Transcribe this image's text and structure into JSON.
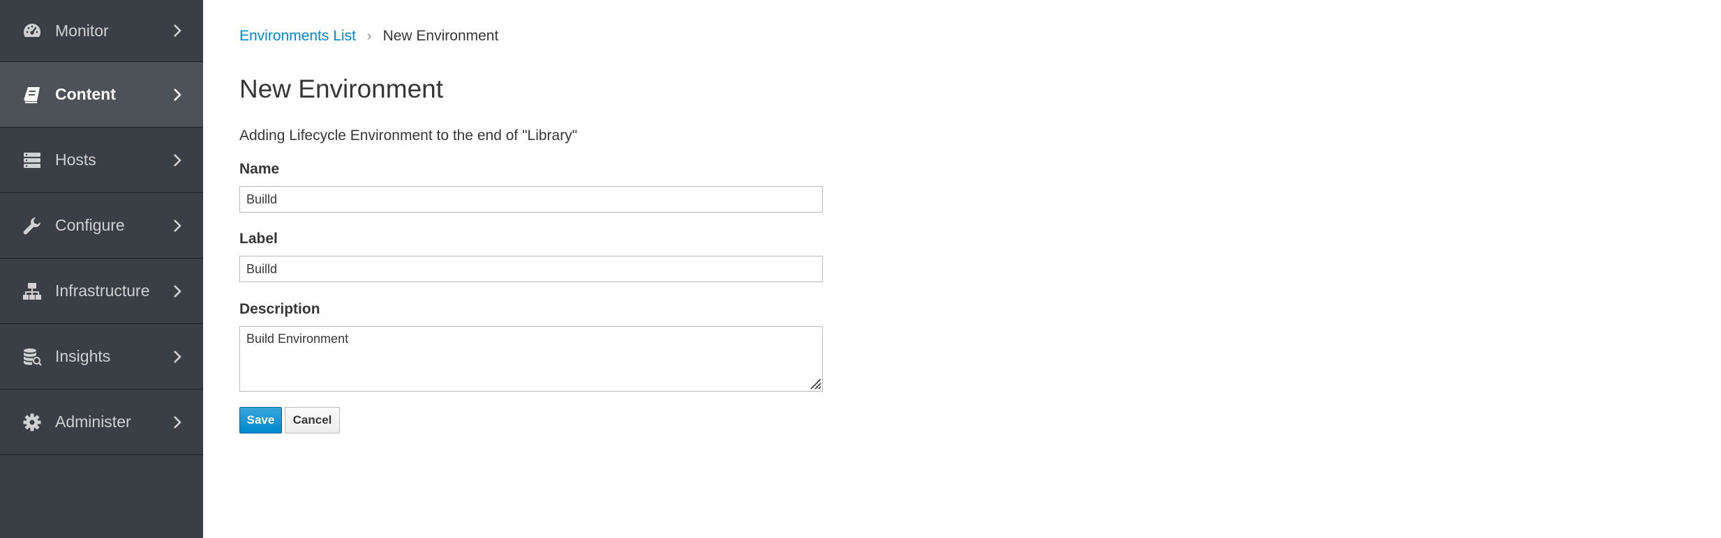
{
  "sidebar": {
    "items": [
      {
        "label": "Monitor",
        "icon": "dashboard-icon",
        "active": false
      },
      {
        "label": "Content",
        "icon": "book-icon",
        "active": true
      },
      {
        "label": "Hosts",
        "icon": "server-icon",
        "active": false
      },
      {
        "label": "Configure",
        "icon": "wrench-icon",
        "active": false
      },
      {
        "label": "Infrastructure",
        "icon": "network-icon",
        "active": false
      },
      {
        "label": "Insights",
        "icon": "database-search-icon",
        "active": false
      },
      {
        "label": "Administer",
        "icon": "gear-icon",
        "active": false
      }
    ]
  },
  "breadcrumb": {
    "parent": "Environments List",
    "separator": "›",
    "current": "New Environment"
  },
  "page": {
    "title": "New Environment",
    "subtitle": "Adding Lifecycle Environment to the end of \"Library\""
  },
  "form": {
    "name_label": "Name",
    "name_value": "Builld",
    "label_label": "Label",
    "label_value": "Builld",
    "description_label": "Description",
    "description_value": "Build Environment"
  },
  "buttons": {
    "save_label": "Save",
    "cancel_label": "Cancel"
  },
  "colors": {
    "sidebar_bg": "#393f44",
    "sidebar_active_bg": "#4d5258",
    "link": "#0088ce",
    "primary_button": "#0088ce"
  }
}
